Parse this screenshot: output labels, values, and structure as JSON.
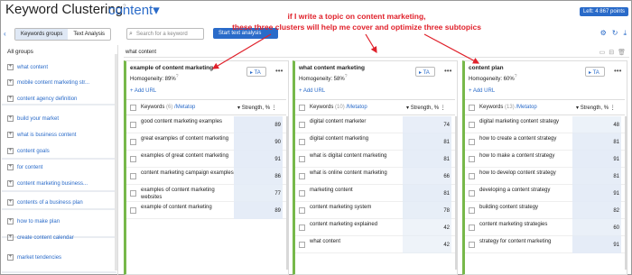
{
  "header": {
    "title": "Keyword Clustering",
    "help": "?",
    "project": "content",
    "chevron": "▾",
    "limit": "Left: 4 867 points"
  },
  "toolbar": {
    "tabs": [
      "Keywords groups",
      "Text Analysis"
    ],
    "search_placeholder": "Search for a keyword",
    "start_button": "Start text analysis"
  },
  "annotation": {
    "line1": "if I write a topic on content marketing,",
    "line2": "these three clusters will help me cover and optimize three subtopics"
  },
  "sidebar": {
    "title": "All groups",
    "items": [
      "what content",
      "mobile content marketing str...",
      "content agency definition",
      "build your market",
      "what is business content",
      "content goals",
      "for content",
      "content marketing business...",
      "contents of a business plan",
      "how to make plan",
      "create content calendar",
      "market tendencies"
    ]
  },
  "group_name": "what content",
  "cards": [
    {
      "name": "example of content marketing",
      "homogeneity": "Homogeneity: 89%",
      "ta": "TA",
      "add_url": "+ Add URL",
      "keywords_label": "Keywords",
      "count": "(6)",
      "metatop": "/Metatop",
      "strength_label": "Strength, %",
      "rows": [
        {
          "kw": "good content marketing examples",
          "val": 89
        },
        {
          "kw": "great examples of content marketing",
          "val": 90
        },
        {
          "kw": "examples of great content marketing",
          "val": 91
        },
        {
          "kw": "content marketing campaign examples",
          "val": 86
        },
        {
          "kw": "examples of content marketing websites",
          "val": 77
        },
        {
          "kw": "example of content marketing",
          "val": 89
        }
      ]
    },
    {
      "name": "what content marketing",
      "homogeneity": "Homogeneity: 58%",
      "ta": "TA",
      "add_url": "+ Add URL",
      "keywords_label": "Keywords",
      "count": "(10)",
      "metatop": "/Metatop",
      "strength_label": "Strength, %",
      "rows": [
        {
          "kw": "digital content marketer",
          "val": 74
        },
        {
          "kw": "digital content marketing",
          "val": 81
        },
        {
          "kw": "what is digital content marketing",
          "val": 81
        },
        {
          "kw": "what is online content marketing",
          "val": 66
        },
        {
          "kw": "marketing content",
          "val": 81
        },
        {
          "kw": "content marketing system",
          "val": 78
        },
        {
          "kw": "content marketing explained",
          "val": 42
        },
        {
          "kw": "what content",
          "val": 42
        }
      ]
    },
    {
      "name": "content plan",
      "homogeneity": "Homogeneity: 60%",
      "ta": "TA",
      "add_url": "+ Add URL",
      "keywords_label": "Keywords",
      "count": "(13)",
      "metatop": "/Metatop",
      "strength_label": "Strength, %",
      "rows": [
        {
          "kw": "digital marketing content strategy",
          "val": 48
        },
        {
          "kw": "how to create a content strategy",
          "val": 81
        },
        {
          "kw": "how to make a content strategy",
          "val": 91
        },
        {
          "kw": "how to develop content strategy",
          "val": 81
        },
        {
          "kw": "developing a content strategy",
          "val": 91
        },
        {
          "kw": "building content strategy",
          "val": 82
        },
        {
          "kw": "content marketing strategies",
          "val": 60
        },
        {
          "kw": "strategy for content marketing",
          "val": 91
        }
      ]
    }
  ]
}
